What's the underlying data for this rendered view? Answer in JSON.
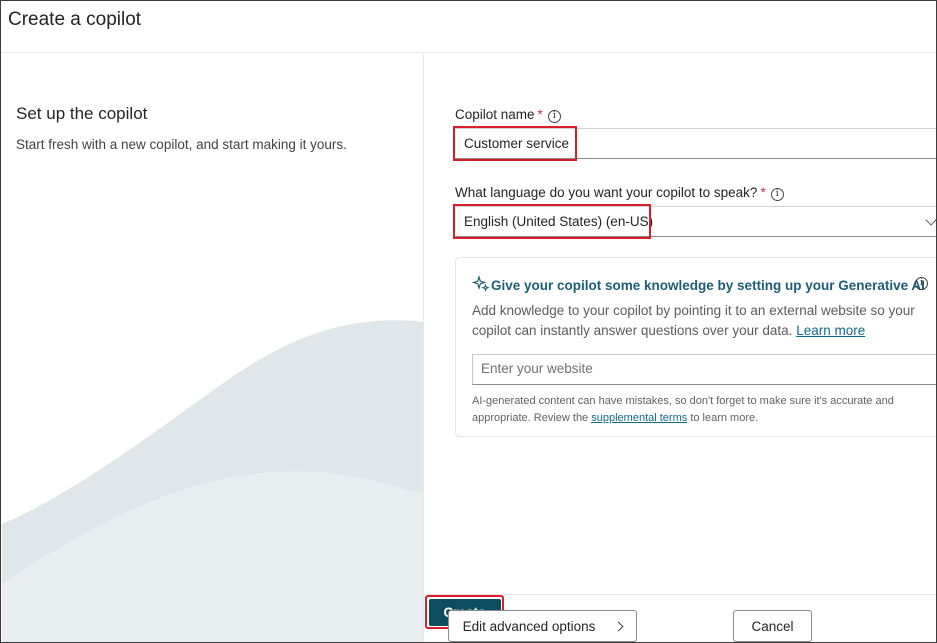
{
  "header": {
    "title": "Create a copilot"
  },
  "left": {
    "heading": "Set up the copilot",
    "subtitle": "Start fresh with a new copilot, and start making it yours."
  },
  "form": {
    "name_label": "Copilot name",
    "name_required": "*",
    "name_value": "Customer service",
    "language_label": "What language do you want your copilot to speak?",
    "language_required": "*",
    "language_value": "English (United States) (en-US)"
  },
  "knowledge": {
    "title": "Give your copilot some knowledge by setting up your Generative AI",
    "description": "Add knowledge to your copilot by pointing it to an external website so your copilot can instantly answer questions over your data.",
    "learn_more": "Learn more",
    "website_placeholder": "Enter your website",
    "disclaimer_before": "AI-generated content can have mistakes, so don't forget to make sure it's accurate and appropriate. Review the",
    "disclaimer_link": "supplemental terms",
    "disclaimer_after": "to learn more."
  },
  "footer": {
    "advanced_label": "Edit advanced options",
    "create_label": "Create",
    "cancel_label": "Cancel"
  },
  "colors": {
    "accent": "#0e4d5f",
    "highlight": "#d91e2a",
    "link": "#0f6b8c",
    "required": "#c4314b"
  },
  "icons": [
    "info-icon",
    "sparkle-icon",
    "chevron-down-icon",
    "chevron-right-icon"
  ]
}
